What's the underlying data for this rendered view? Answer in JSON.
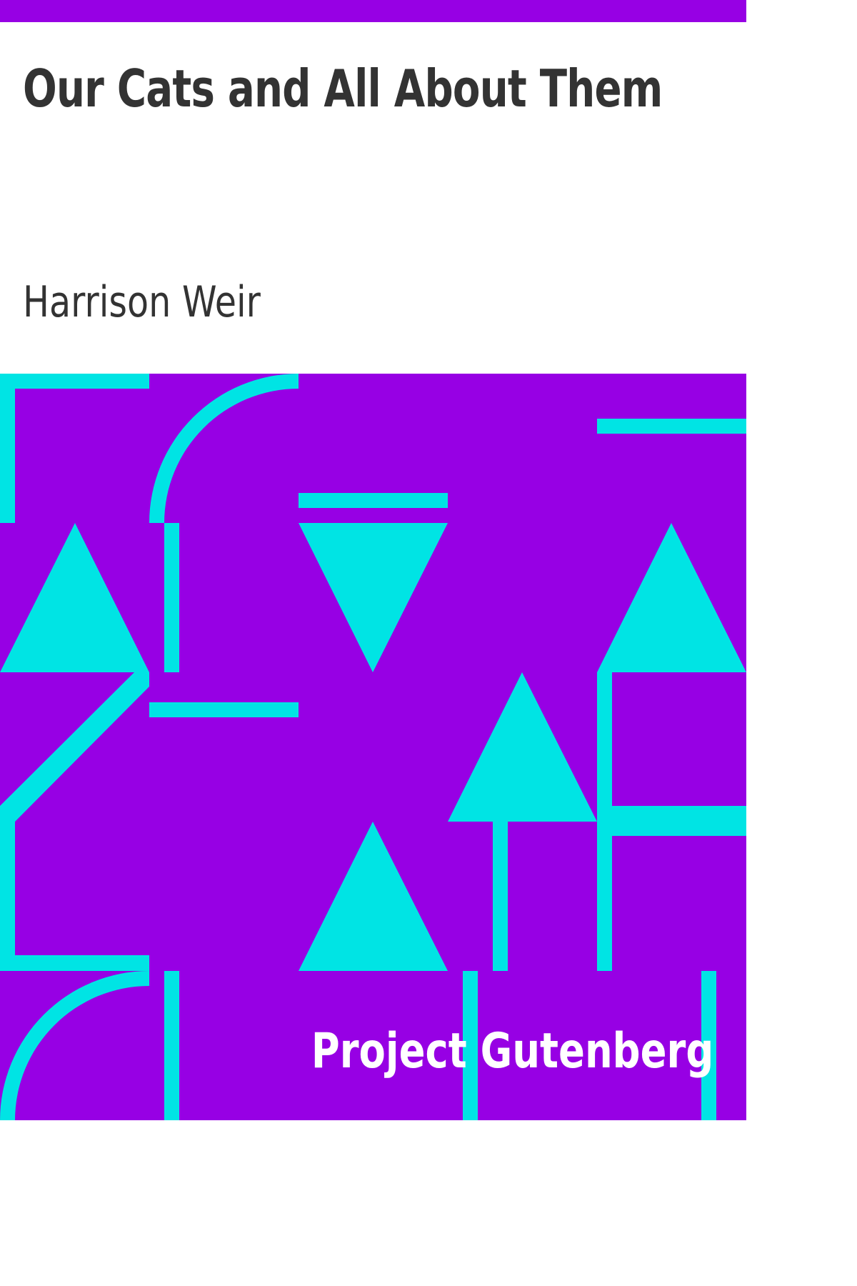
{
  "book": {
    "title": "Our Cats and All About Them",
    "author": "Harrison Weir",
    "publisher": "Project Gutenberg"
  },
  "colors": {
    "background": "#9700e4",
    "pattern": "#00e4e4",
    "title_text": "#333333",
    "publisher_text": "#ffffff",
    "title_area": "#ffffff"
  }
}
